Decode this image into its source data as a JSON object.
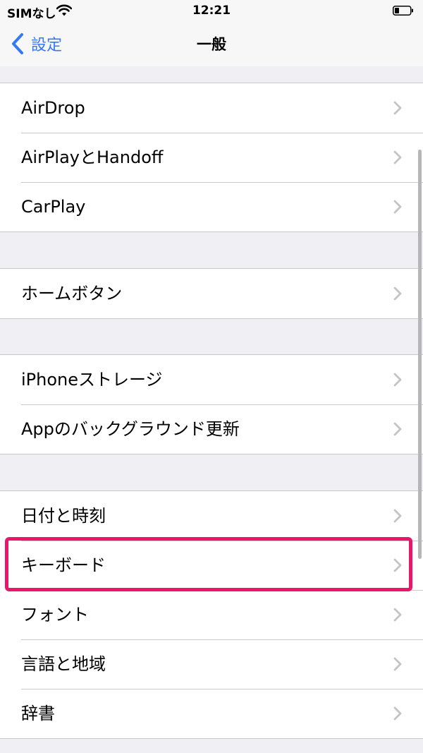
{
  "status_bar": {
    "carrier": "SIMなし",
    "time": "12:21"
  },
  "nav": {
    "back_label": "設定",
    "title": "一般"
  },
  "groups": [
    {
      "items": [
        "AirDrop",
        "AirPlayとHandoff",
        "CarPlay"
      ]
    },
    {
      "items": [
        "ホームボタン"
      ]
    },
    {
      "items": [
        "iPhoneストレージ",
        "Appのバックグラウンド更新"
      ]
    },
    {
      "items": [
        "日付と時刻",
        "キーボード",
        "フォント",
        "言語と地域",
        "辞書"
      ]
    }
  ],
  "highlighted_item": "キーボード",
  "colors": {
    "accent": "#3478f6",
    "highlight": "#e8176a",
    "background": "#efeff4"
  }
}
